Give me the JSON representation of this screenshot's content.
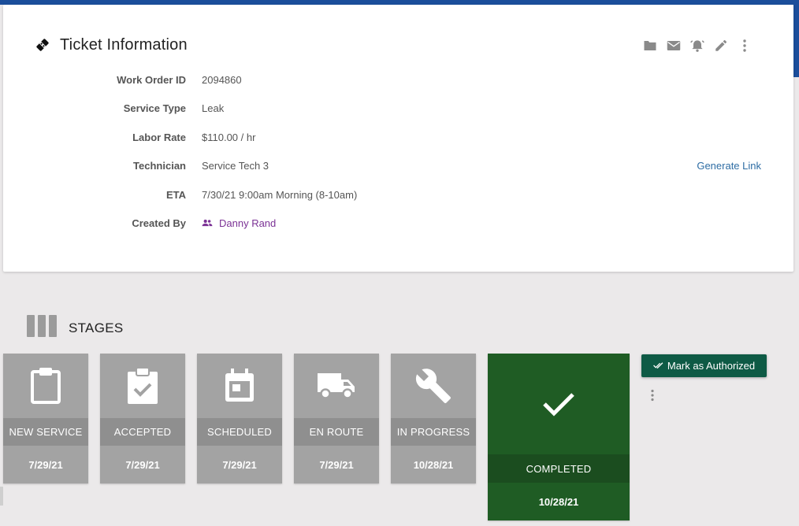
{
  "ticket": {
    "title": "Ticket Information",
    "header_icon": "ticket-icon",
    "toolbar": [
      {
        "name": "folder-button",
        "icon": "folder-icon"
      },
      {
        "name": "email-button",
        "icon": "mail-icon"
      },
      {
        "name": "alarm-button",
        "icon": "alarm-icon"
      },
      {
        "name": "edit-button",
        "icon": "pencil-icon"
      },
      {
        "name": "more-button",
        "icon": "kebab-icon"
      }
    ],
    "fields": {
      "work_order_label": "Work Order ID",
      "work_order_value": "2094860",
      "service_type_label": "Service Type",
      "service_type_value": "Leak",
      "labor_rate_label": "Labor Rate",
      "labor_rate_value": "$110.00 / hr",
      "technician_label": "Technician",
      "technician_value": "Service Tech 3",
      "eta_label": "ETA",
      "eta_value": "7/30/21 9:00am Morning (8-10am)",
      "created_by_label": "Created By",
      "created_by_value": "Danny Rand"
    },
    "generate_link": "Generate Link"
  },
  "stages": {
    "title": "STAGES",
    "items": [
      {
        "name": "NEW SERVICE",
        "date": "7/29/21",
        "icon": "clipboard-icon",
        "status": "complete"
      },
      {
        "name": "ACCEPTED",
        "date": "7/29/21",
        "icon": "clipboard-check-icon",
        "status": "complete"
      },
      {
        "name": "SCHEDULED",
        "date": "7/29/21",
        "icon": "calendar-icon",
        "status": "complete"
      },
      {
        "name": "EN ROUTE",
        "date": "7/29/21",
        "icon": "truck-icon",
        "status": "complete"
      },
      {
        "name": "IN PROGRESS",
        "date": "10/28/21",
        "icon": "wrench-icon",
        "status": "complete"
      },
      {
        "name": "COMPLETED",
        "date": "10/28/21",
        "icon": "check-icon",
        "status": "current"
      }
    ],
    "authorize_label": "Mark as Authorized"
  },
  "colors": {
    "brand_blue": "#1b4e9b",
    "stage_gray": "#a3a3a3",
    "stage_current_green": "#1f5c24",
    "authorize_green": "#0e5a45",
    "link_blue": "#2e6da4",
    "creator_purple": "#7b3295"
  }
}
